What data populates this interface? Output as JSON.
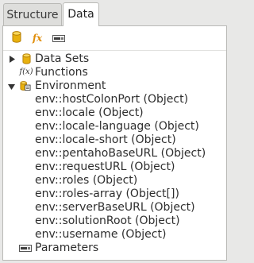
{
  "tabs": [
    {
      "label": "Structure",
      "active": false
    },
    {
      "label": "Data",
      "active": true
    }
  ],
  "toolbar": {
    "buttons": [
      {
        "icon": "database-icon"
      },
      {
        "icon": "function-icon",
        "glyph": "fx"
      },
      {
        "icon": "parameter-icon"
      }
    ]
  },
  "tree": {
    "data_sets": {
      "label": "Data Sets",
      "expanded": false
    },
    "functions": {
      "label": "Functions",
      "glyph": "f(x)"
    },
    "environment": {
      "label": "Environment",
      "expanded": true,
      "items": [
        "env::hostColonPort (Object)",
        "env::locale (Object)",
        "env::locale-language (Object)",
        "env::locale-short (Object)",
        "env::pentahoBaseURL (Object)",
        "env::requestURL (Object)",
        "env::roles (Object)",
        "env::roles-array (Object[])",
        "env::serverBaseURL (Object)",
        "env::solutionRoot (Object)",
        "env::username (Object)"
      ]
    },
    "parameters": {
      "label": "Parameters"
    }
  },
  "colors": {
    "accent_gold": "#e8b10e",
    "fx_orange": "#e08e0b",
    "panel_bg": "#ffffff",
    "window_bg": "#e8e8e7"
  }
}
